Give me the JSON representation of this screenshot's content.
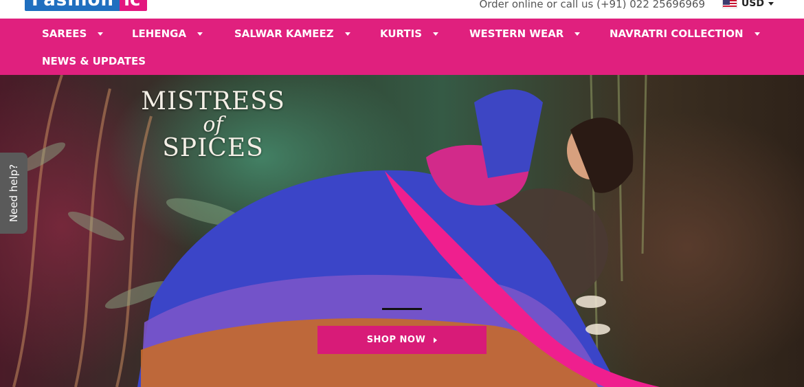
{
  "brand": {
    "logo_main": "Fashion",
    "logo_accent": "ic"
  },
  "topbar": {
    "contact_text": "Order online or call us (+91) 022 25696969",
    "currency": "USD",
    "currency_flag_icon": "us-flag-icon"
  },
  "nav": {
    "items": [
      {
        "label": "SAREES",
        "has_dropdown": true
      },
      {
        "label": "LEHENGA",
        "has_dropdown": true
      },
      {
        "label": "SALWAR KAMEEZ",
        "has_dropdown": true
      },
      {
        "label": "KURTIS",
        "has_dropdown": true
      },
      {
        "label": "WESTERN WEAR",
        "has_dropdown": true
      },
      {
        "label": "NAVRATRI COLLECTION",
        "has_dropdown": true
      },
      {
        "label": "NEWS & UPDATES",
        "has_dropdown": false
      }
    ]
  },
  "hero": {
    "title_line1": "MISTRESS",
    "title_line2": "of",
    "title_line3": "SPICES",
    "cta_label": "SHOP NOW",
    "cta_icon": "chevron-right-icon"
  },
  "help_tab": {
    "label": "Need help?"
  },
  "colors": {
    "brand_pink": "#e0207e",
    "cta_pink": "#d81b78",
    "logo_blue": "#1f6fbf",
    "help_gray": "#5a5a5a"
  }
}
